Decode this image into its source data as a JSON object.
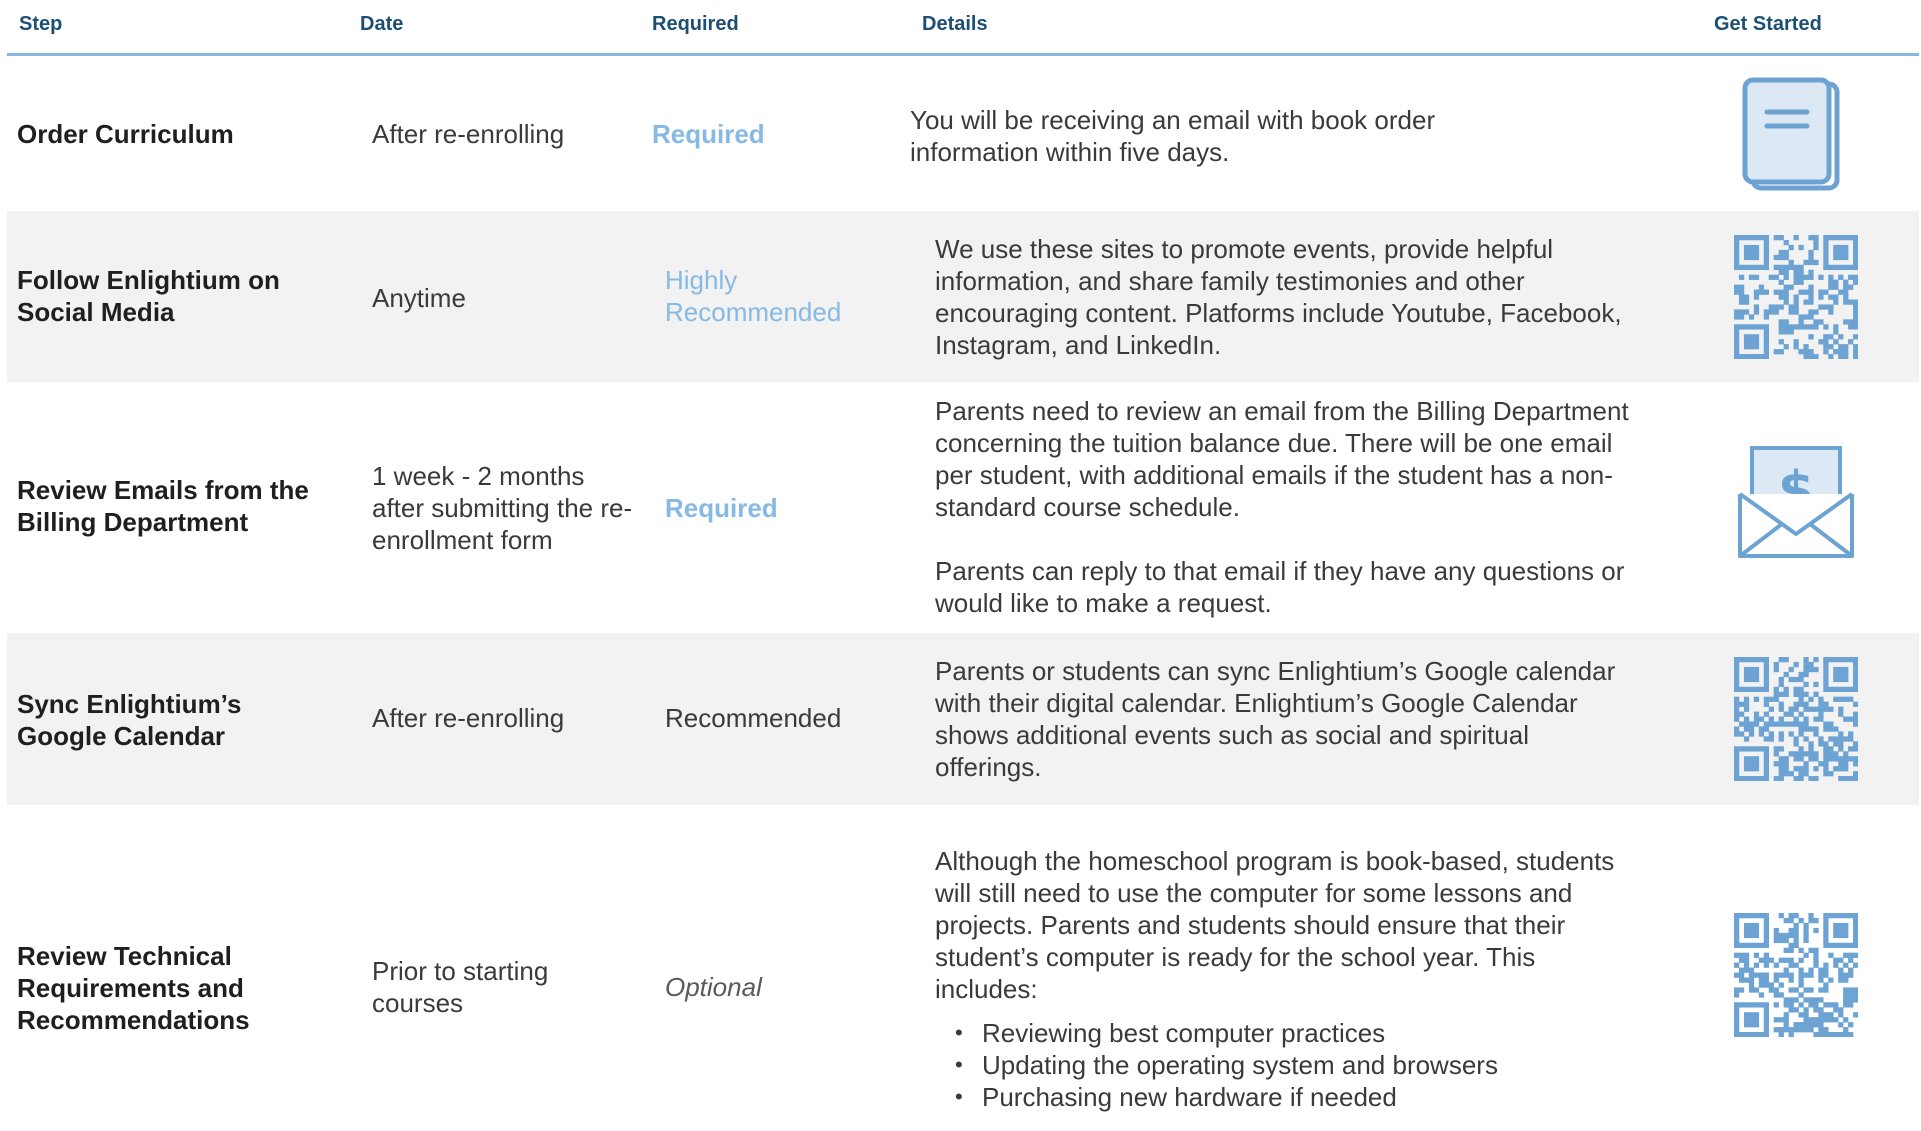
{
  "header": {
    "step": "Step",
    "date": "Date",
    "required": "Required",
    "details": "Details",
    "get_started": "Get Started"
  },
  "rows": [
    {
      "step": "Order Curriculum",
      "date": "After re-enrolling",
      "required": "Required",
      "details": "You will be receiving an email with book order information within five days.",
      "icon": "book-icon"
    },
    {
      "step": "Follow Enlightium on Social Media",
      "date": "Anytime",
      "required": "Highly Recommended",
      "details": "We use these sites to promote events, provide helpful information, and share family testimonies and other encouraging content. Platforms include Youtube, Facebook, Instagram, and LinkedIn.",
      "icon": "qr-code-icon"
    },
    {
      "step": "Review Emails from the Billing Department",
      "date": "1 week - 2 months after submitting the re-enrollment form",
      "required": "Required",
      "details": "Parents need to review an email from the Billing Department concerning the tuition balance due. There will be one email per student, with additional emails if the student has a non-standard course schedule.",
      "details_2": "Parents can reply to that email if they have any questions or would like to make a request.",
      "icon": "envelope-dollar-icon"
    },
    {
      "step": "Sync Enlightium’s Google Calendar",
      "date": "After re-enrolling",
      "required": "Recommended",
      "details": "Parents or students can sync Enlightium’s Google calendar with their digital calendar. Enlightium’s Google Calendar shows additional events such as social and spiritual offerings.",
      "icon": "qr-code-icon"
    },
    {
      "step": "Review Technical Requirements and Recommendations",
      "date": "Prior to starting courses",
      "required": "Optional",
      "details": "Although the homeschool program is book-based, students will still need to use the computer for some lessons and projects. Parents and students should ensure that their student’s computer is ready for the school year. This includes:",
      "bullets": [
        "Reviewing best computer practices",
        "Updating the operating system and browsers",
        "Purchasing new hardware if needed"
      ],
      "icon": "qr-code-icon"
    }
  ],
  "colors": {
    "header_text": "#1c4f73",
    "header_rule": "#86b9dd",
    "accent": "#86b9e4",
    "icon": "#6da3d3",
    "row_shade": "#f2f2f2"
  }
}
